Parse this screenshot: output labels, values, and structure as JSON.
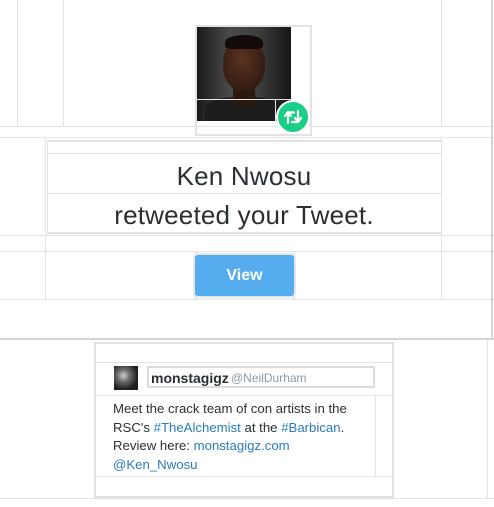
{
  "notification": {
    "line1": "Ken Nwosu",
    "line2": "retweeted your Tweet.",
    "avatar_alt": "Ken Nwosu profile photo",
    "badge_icon": "retweet-icon",
    "badge_color": "#19cf86"
  },
  "cta": {
    "label": "View",
    "color": "#55acee"
  },
  "tweet": {
    "display_name": "monstagigz",
    "handle": "@NeilDurham",
    "text_parts": {
      "p1": "Meet the crack team of con artists in the RSC's ",
      "h1": "#TheAlchemist",
      "p2": " at the ",
      "h2": "#Barbican",
      "p3": ". Review here: ",
      "link": "monstagigz.com",
      "mention": "@Ken_Nwosu"
    },
    "link_color": "#2b7bb9"
  }
}
